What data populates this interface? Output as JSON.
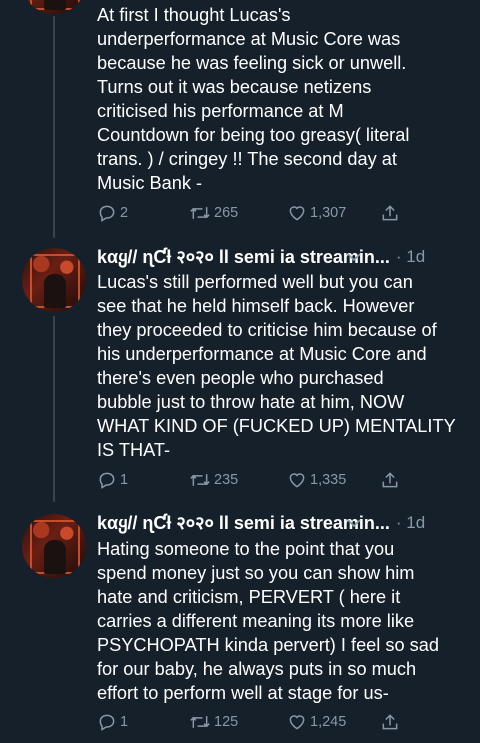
{
  "tweets": [
    {
      "lines": [
        "At first I thought Lucas's",
        "underperformance at Music Core was",
        "because he was feeling sick or unwell.",
        "Turns out it was because netizens",
        "criticised his performance at M",
        "Countdown for being too greasy( literal",
        "trans. ) / cringey !! The second day at",
        "Music Bank -"
      ],
      "replies": "2",
      "retweets": "265",
      "likes": "1,307"
    },
    {
      "name": "kαყ// ɳƇƚ २०२० ll semi ia streamin...",
      "time": "· 1d",
      "lines": [
        "Lucas's still performed well but you can",
        "see that he held himself back. However",
        "they proceeded to criticise him because of",
        "his underperformance at Music Core and",
        "there's even people who purchased",
        "bubble just to throw hate at him, NOW",
        "WHAT KIND OF (FUCKED UP) MENTALITY",
        "IS THAT-"
      ],
      "replies": "1",
      "retweets": "235",
      "likes": "1,335"
    },
    {
      "name": "kαყ// ɳƇƚ २०२० ll semi ia streamin...",
      "time": "· 1d",
      "lines": [
        "Hating someone to the point that you",
        "spend money just so you can show him",
        "hate and criticism, PERVERT ( here it",
        "carries a different meaning its more like",
        "PSYCHOPATH kinda pervert) I feel so sad",
        "for our baby, he always puts in so much",
        "effort to perform well at stage for us-"
      ],
      "replies": "1",
      "retweets": "125",
      "likes": "1,245"
    }
  ],
  "icons": {
    "reply": "reply-icon",
    "retweet": "retweet-icon",
    "like": "heart-icon",
    "share": "share-icon",
    "menu": "chevron-down-icon"
  },
  "colors": {
    "background": "#15202b",
    "text": "#ffffff",
    "secondary": "#8899a6",
    "thread_line": "#38444d"
  }
}
